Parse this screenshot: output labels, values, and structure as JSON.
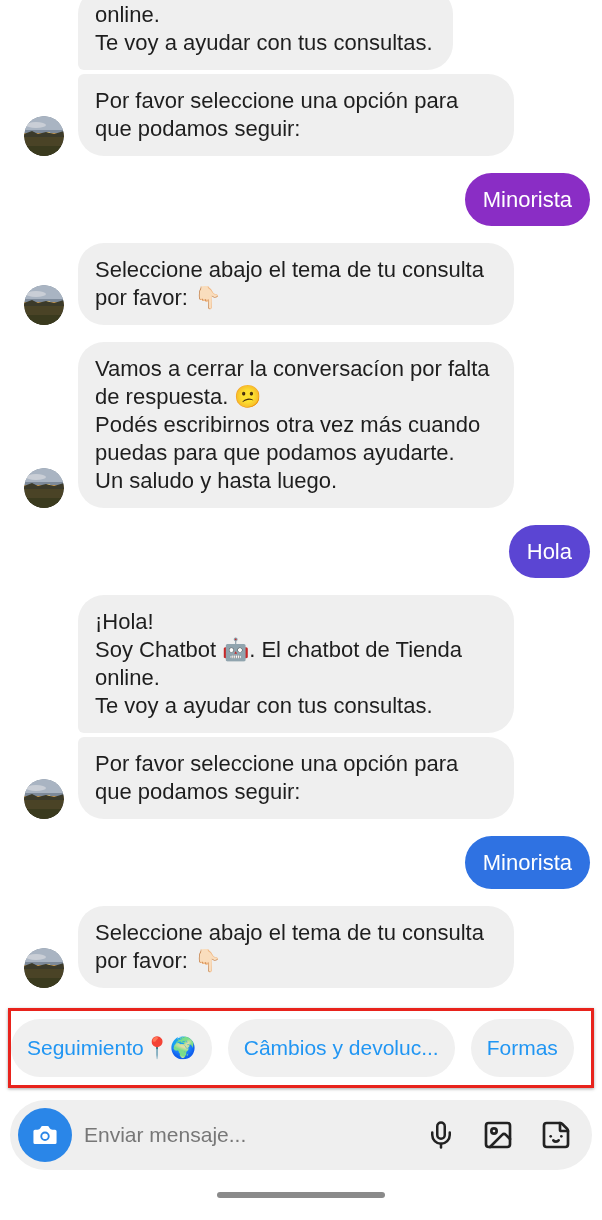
{
  "messages": [
    {
      "kind": "bot",
      "bubbles": [
        "online.\nTe voy a ayudar con tus consultas.",
        "Por favor seleccione una opción para que podamos seguir:"
      ]
    },
    {
      "kind": "user",
      "color": "#8a2dc5",
      "bubbles": [
        "Minorista"
      ]
    },
    {
      "kind": "bot",
      "bubbles": [
        "Seleccione abajo el tema de tu consulta por favor: 👇🏻"
      ]
    },
    {
      "kind": "bot",
      "bubbles": [
        "Vamos a cerrar la conversacíon por falta de respuesta. 😕\nPodés escribirnos otra vez más cuando puedas para que podamos ayudarte.\nUn saludo y hasta luego."
      ]
    },
    {
      "kind": "user",
      "color": "#5b45d3",
      "bubbles": [
        "Hola"
      ]
    },
    {
      "kind": "bot",
      "bubbles": [
        "¡Hola!\nSoy Chatbot 🤖. El chatbot de Tienda online.\nTe voy a ayudar con tus consultas.",
        "Por favor seleccione una opción para que podamos seguir:"
      ]
    },
    {
      "kind": "user",
      "color": "#2f72e2",
      "bubbles": [
        "Minorista"
      ]
    },
    {
      "kind": "bot",
      "bubbles": [
        "Seleccione abajo el tema de tu consulta por favor: 👇🏻"
      ]
    }
  ],
  "quick_replies": {
    "highlighted": true,
    "items": [
      "Seguimiento📍🌍",
      "Câmbios y devoluc...",
      "Formas"
    ]
  },
  "composer": {
    "placeholder": "Enviar mensaje..."
  }
}
